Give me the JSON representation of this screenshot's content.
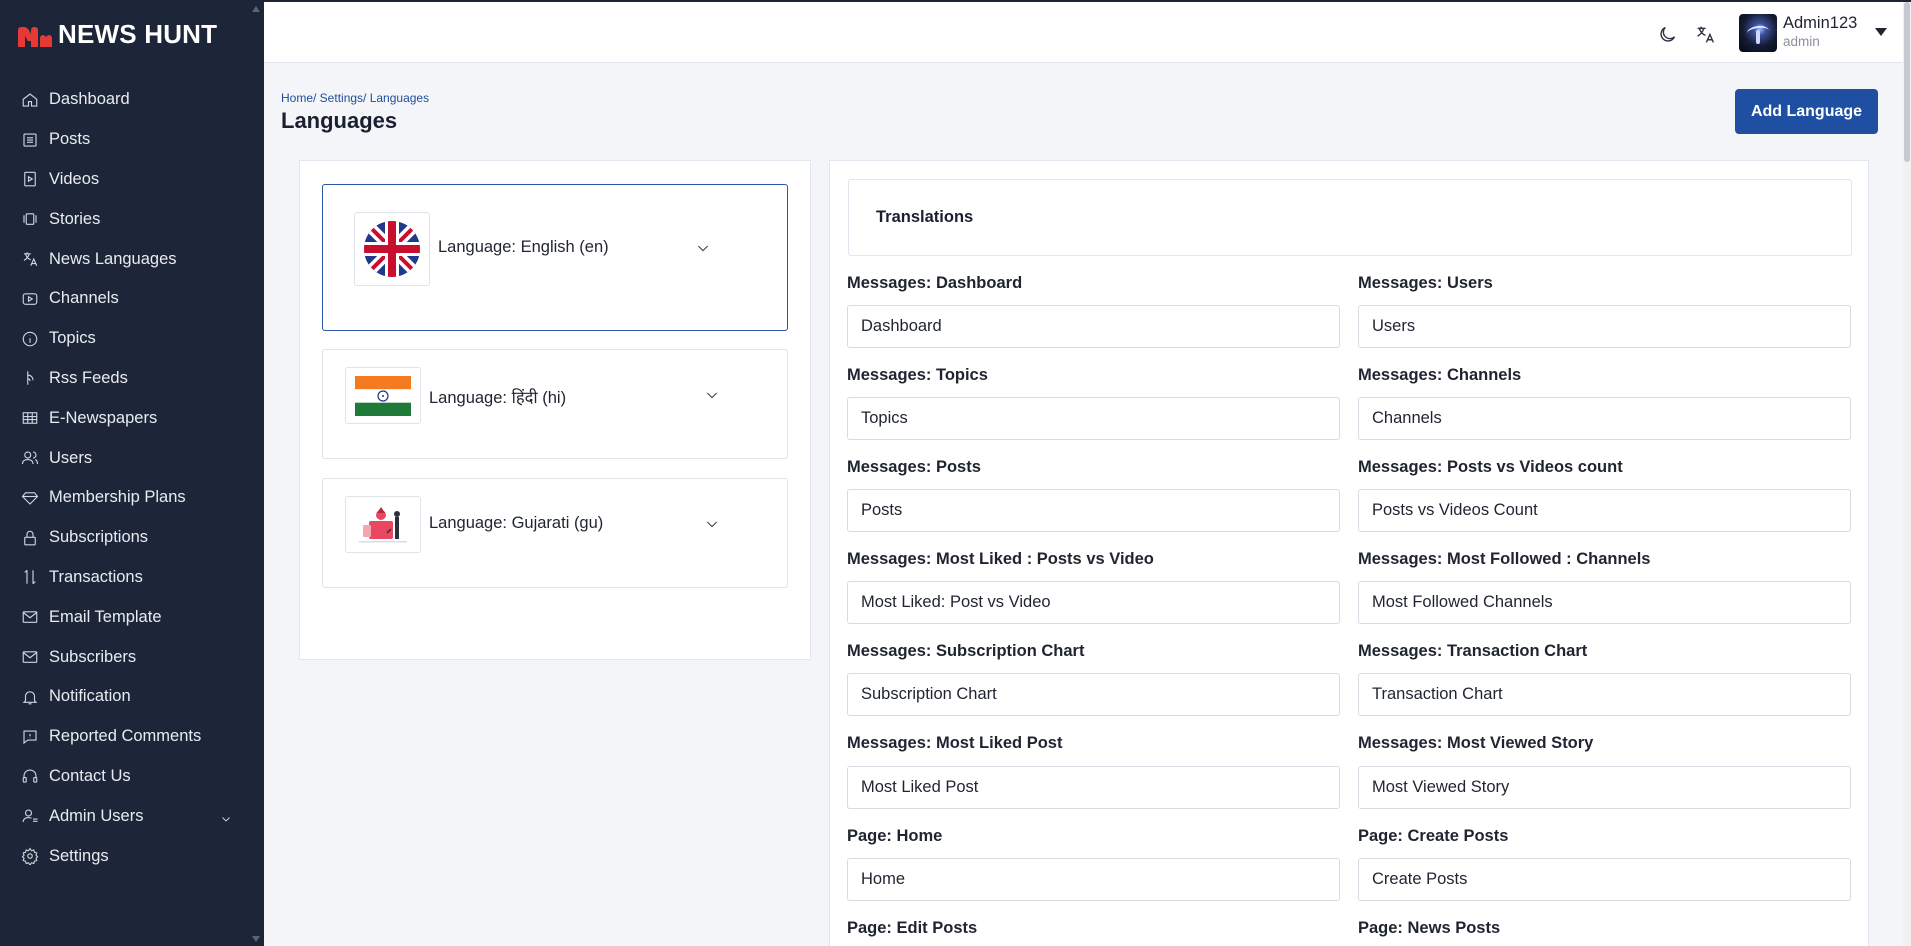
{
  "app": {
    "logo_mark": "N",
    "logo_text": "NEWS HUNT"
  },
  "sidebar": {
    "items": [
      {
        "label": "Dashboard",
        "icon": "home-icon"
      },
      {
        "label": "Posts",
        "icon": "posts-icon"
      },
      {
        "label": "Videos",
        "icon": "video-icon"
      },
      {
        "label": "Stories",
        "icon": "stories-icon"
      },
      {
        "label": "News Languages",
        "icon": "translate-icon"
      },
      {
        "label": "Channels",
        "icon": "channel-icon"
      },
      {
        "label": "Topics",
        "icon": "info-icon"
      },
      {
        "label": "Rss Feeds",
        "icon": "rss-icon"
      },
      {
        "label": "E-Newspapers",
        "icon": "newspaper-icon"
      },
      {
        "label": "Users",
        "icon": "users-icon"
      },
      {
        "label": "Membership Plans",
        "icon": "diamond-icon"
      },
      {
        "label": "Subscriptions",
        "icon": "lock-icon"
      },
      {
        "label": "Transactions",
        "icon": "transfer-icon"
      },
      {
        "label": "Email Template",
        "icon": "mail-icon"
      },
      {
        "label": "Subscribers",
        "icon": "mail-icon"
      },
      {
        "label": "Notification",
        "icon": "bell-icon"
      },
      {
        "label": "Reported Comments",
        "icon": "comment-icon"
      },
      {
        "label": "Contact Us",
        "icon": "headset-icon"
      },
      {
        "label": "Admin Users",
        "icon": "admin-user-icon",
        "has_submenu": true
      },
      {
        "label": "Settings",
        "icon": "gear-icon"
      }
    ]
  },
  "header": {
    "theme_toggle_icon": "moon-icon",
    "language_icon": "translate-icon",
    "user": {
      "name": "Admin123",
      "role": "admin"
    }
  },
  "page": {
    "breadcrumb": [
      "Home/",
      " Settings/",
      " Languages"
    ],
    "title": "Languages",
    "add_button_label": "Add Language"
  },
  "languages": [
    {
      "label": "Language: English (en)",
      "flag": "uk-flag",
      "active": true
    },
    {
      "label": "Language: हिंदी (hi)",
      "flag": "india-flag",
      "active": false
    },
    {
      "label": "Language: Gujarati (gu)",
      "flag": "gujarati-illustration",
      "active": false
    }
  ],
  "translations": {
    "title": "Translations",
    "fields": [
      {
        "label": "Messages: Dashboard",
        "value": "Dashboard"
      },
      {
        "label": "Messages: Users",
        "value": "Users"
      },
      {
        "label": "Messages: Topics",
        "value": "Topics"
      },
      {
        "label": "Messages: Channels",
        "value": "Channels"
      },
      {
        "label": "Messages: Posts",
        "value": "Posts"
      },
      {
        "label": "Messages: Posts vs Videos count",
        "value": "Posts vs Videos Count"
      },
      {
        "label": "Messages: Most Liked : Posts vs Video",
        "value": "Most Liked: Post vs Video"
      },
      {
        "label": "Messages: Most Followed : Channels",
        "value": "Most Followed Channels"
      },
      {
        "label": "Messages: Subscription Chart",
        "value": "Subscription Chart"
      },
      {
        "label": "Messages: Transaction Chart",
        "value": "Transaction Chart"
      },
      {
        "label": "Messages: Most Liked Post",
        "value": "Most Liked Post"
      },
      {
        "label": "Messages: Most Viewed Story",
        "value": "Most Viewed Story"
      },
      {
        "label": "Page: Home",
        "value": "Home"
      },
      {
        "label": "Page: Create Posts",
        "value": "Create Posts"
      },
      {
        "label": "Page: Edit Posts",
        "value": ""
      },
      {
        "label": "Page: News Posts",
        "value": ""
      }
    ]
  },
  "colors": {
    "sidebar_bg": "#1d2638",
    "accent": "#1e4fa2",
    "logo_red": "#e53935",
    "page_bg": "#f3f5f9"
  }
}
